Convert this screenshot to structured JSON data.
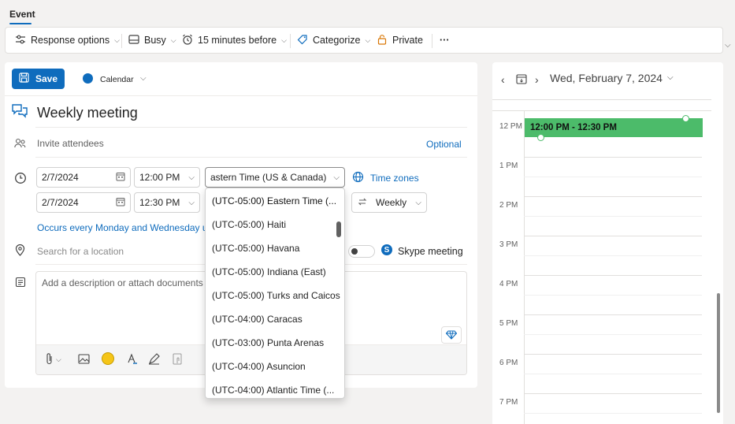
{
  "tabs": {
    "active": "Event"
  },
  "ribbon": {
    "response_options": "Response options",
    "busy": "Busy",
    "reminder": "15 minutes before",
    "categorize": "Categorize",
    "private": "Private",
    "more": "···"
  },
  "form": {
    "save_label": "Save",
    "calendar_label": "Calendar",
    "title": "Weekly meeting",
    "invite_placeholder": "Invite attendees",
    "optional_link": "Optional",
    "start_date": "2/7/2024",
    "start_time": "12:00 PM",
    "timezone_value": "astern Time (US & Canada)",
    "time_zones_link": "Time zones",
    "end_date": "2/7/2024",
    "end_time": "12:30 PM",
    "recurrence": "Weekly",
    "occurs_text": "Occurs every Monday and Wednesday un",
    "location_placeholder": "Search for a location",
    "skype_label": "Skype meeting",
    "description_placeholder": "Add a description or attach documents"
  },
  "timezone_dropdown": {
    "options": [
      "(UTC-05:00) Eastern Time (...",
      "(UTC-05:00) Haiti",
      "(UTC-05:00) Havana",
      "(UTC-05:00) Indiana (East)",
      "(UTC-05:00) Turks and Caicos",
      "(UTC-04:00) Caracas",
      "(UTC-03:00) Punta Arenas",
      "(UTC-04:00) Asuncion",
      "(UTC-04:00) Atlantic Time (..."
    ],
    "selected_index": 0
  },
  "calendar_view": {
    "date_label": "Wed, February 7, 2024",
    "hours": [
      "12 PM",
      "1 PM",
      "2 PM",
      "3 PM",
      "4 PM",
      "5 PM",
      "6 PM",
      "7 PM"
    ],
    "event_label": "12:00 PM - 12:30 PM",
    "event_color": "#4cbb6a"
  },
  "colors": {
    "accent": "#0f6cbd"
  }
}
